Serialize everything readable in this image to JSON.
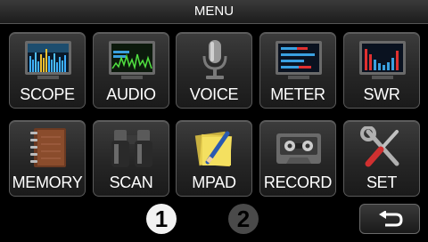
{
  "title": "MENU",
  "tiles": [
    {
      "label": "SCOPE",
      "icon": "spectrum-scope-icon"
    },
    {
      "label": "AUDIO",
      "icon": "audio-scope-icon"
    },
    {
      "label": "VOICE",
      "icon": "microphone-icon"
    },
    {
      "label": "METER",
      "icon": "meter-icon"
    },
    {
      "label": "SWR",
      "icon": "swr-graph-icon"
    },
    {
      "label": "MEMORY",
      "icon": "notebook-icon"
    },
    {
      "label": "SCAN",
      "icon": "binoculars-icon"
    },
    {
      "label": "MPAD",
      "icon": "memo-pad-icon"
    },
    {
      "label": "RECORD",
      "icon": "cassette-icon"
    },
    {
      "label": "SET",
      "icon": "tools-icon"
    }
  ],
  "pages": [
    "1",
    "2"
  ],
  "active_page": "1",
  "back_icon": "return-arrow-icon"
}
